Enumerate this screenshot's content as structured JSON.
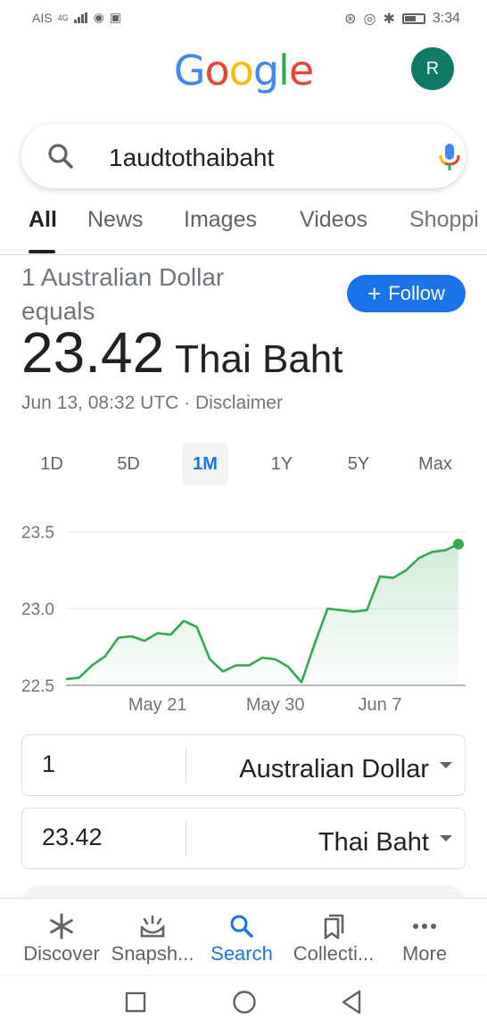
{
  "status_bar": {
    "carrier": "AIS",
    "network": "4G",
    "time": "3:34"
  },
  "header": {
    "logo_letters": [
      {
        "ch": "G",
        "color": "#4285F4"
      },
      {
        "ch": "o",
        "color": "#EA4335"
      },
      {
        "ch": "o",
        "color": "#FBBC05"
      },
      {
        "ch": "g",
        "color": "#4285F4"
      },
      {
        "ch": "l",
        "color": "#34A853"
      },
      {
        "ch": "e",
        "color": "#EA4335"
      }
    ],
    "avatar_initial": "R",
    "avatar_color": "#0F7A68"
  },
  "search": {
    "query": "1audtothaibaht"
  },
  "tabs": [
    {
      "label": "All",
      "active": true
    },
    {
      "label": "News",
      "active": false
    },
    {
      "label": "Images",
      "active": false
    },
    {
      "label": "Videos",
      "active": false
    },
    {
      "label": "Shoppi",
      "active": false
    }
  ],
  "result": {
    "equals_line1": "1 Australian Dollar",
    "equals_line2": "equals",
    "follow_label": "Follow",
    "value": "23.42",
    "unit": "Thai Baht",
    "timestamp": "Jun 13, 08:32 UTC",
    "separator": "·",
    "disclaimer": "Disclaimer"
  },
  "ranges": [
    {
      "label": "1D",
      "active": false
    },
    {
      "label": "5D",
      "active": false
    },
    {
      "label": "1M",
      "active": true
    },
    {
      "label": "1Y",
      "active": false
    },
    {
      "label": "5Y",
      "active": false
    },
    {
      "label": "Max",
      "active": false
    }
  ],
  "chart_data": {
    "type": "area",
    "y_ticks": [
      "23.5",
      "23.0",
      "22.5"
    ],
    "x_ticks": [
      "May 21",
      "May 30",
      "Jun 7"
    ],
    "ylim": [
      22.5,
      23.5
    ],
    "x": [
      "May 14",
      "May 15",
      "May 16",
      "May 17",
      "May 18",
      "May 19",
      "May 20",
      "May 21",
      "May 22",
      "May 23",
      "May 24",
      "May 25",
      "May 26",
      "May 27",
      "May 28",
      "May 29",
      "May 30",
      "May 31",
      "Jun 1",
      "Jun 2",
      "Jun 3",
      "Jun 4",
      "Jun 5",
      "Jun 6",
      "Jun 7",
      "Jun 8",
      "Jun 9",
      "Jun 10",
      "Jun 11",
      "Jun 12",
      "Jun 13"
    ],
    "values": [
      22.54,
      22.55,
      22.63,
      22.69,
      22.81,
      22.82,
      22.79,
      22.84,
      22.83,
      22.92,
      22.88,
      22.67,
      22.59,
      22.63,
      22.63,
      22.68,
      22.67,
      22.62,
      22.52,
      22.77,
      23.0,
      22.99,
      22.98,
      22.99,
      23.21,
      23.2,
      23.25,
      23.33,
      23.37,
      23.38,
      23.42
    ],
    "line_color": "#34A853",
    "grid": true
  },
  "converter": {
    "from_value": "1",
    "from_currency": "Australian Dollar",
    "to_value": "23.42",
    "to_currency": "Thai Baht"
  },
  "bottom_nav": [
    {
      "label": "Discover",
      "icon": "asterisk-icon",
      "active": false
    },
    {
      "label": "Snapsh...",
      "icon": "snapshot-icon",
      "active": false
    },
    {
      "label": "Search",
      "icon": "search-icon",
      "active": true
    },
    {
      "label": "Collecti...",
      "icon": "collections-icon",
      "active": false
    },
    {
      "label": "More",
      "icon": "more-dots-icon",
      "active": false
    }
  ],
  "colors": {
    "accent": "#1A73E8",
    "chart_green": "#34A853"
  }
}
